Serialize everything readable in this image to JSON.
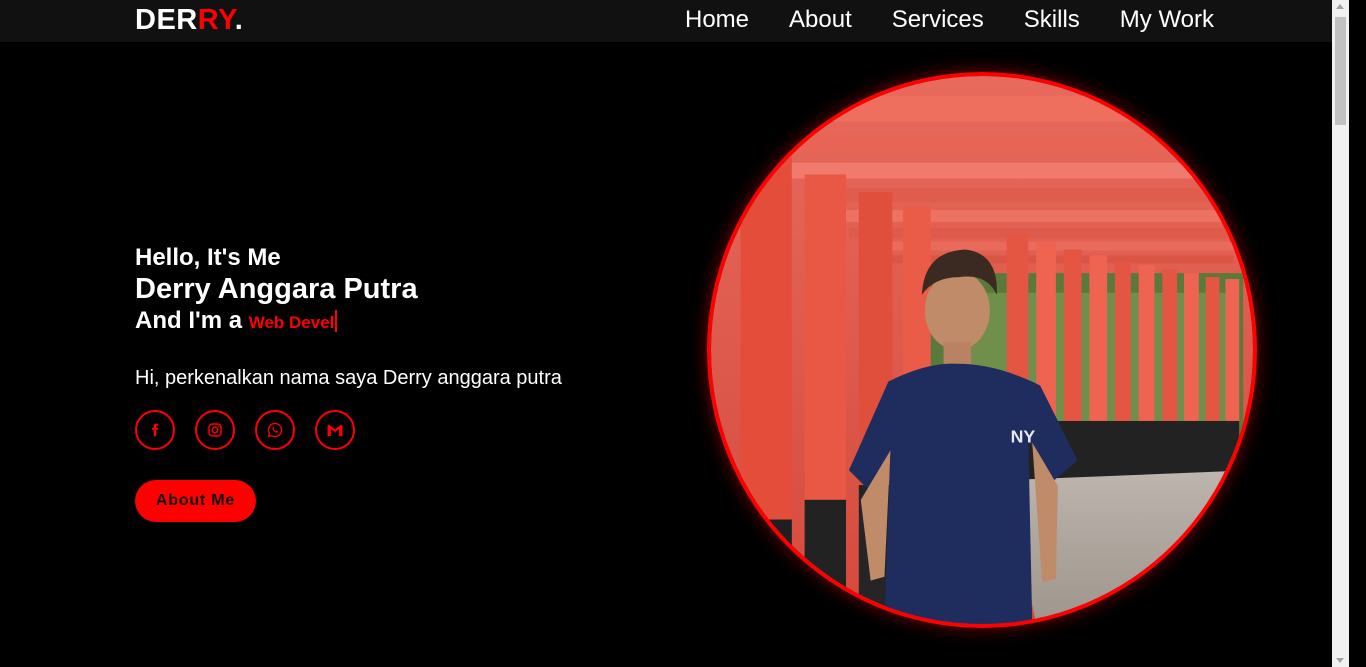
{
  "nav": {
    "logo_main": "DER",
    "logo_accent": "RY",
    "logo_dot": ".",
    "links": [
      "Home",
      "About",
      "Services",
      "Skills",
      "My Work"
    ]
  },
  "hero": {
    "greeting": "Hello, It's Me",
    "name": "Derry Anggara Putra",
    "role_prefix": "And I'm a",
    "role_typed": "Web Devel",
    "intro": "Hi, perkenalkan nama saya Derry anggara putra",
    "socials": [
      "facebook-icon",
      "instagram-icon",
      "whatsapp-icon",
      "gmail-icon"
    ],
    "button_label": "About Me"
  },
  "colors": {
    "accent": "#ff0000",
    "background": "#000000",
    "navbar": "#111111"
  }
}
